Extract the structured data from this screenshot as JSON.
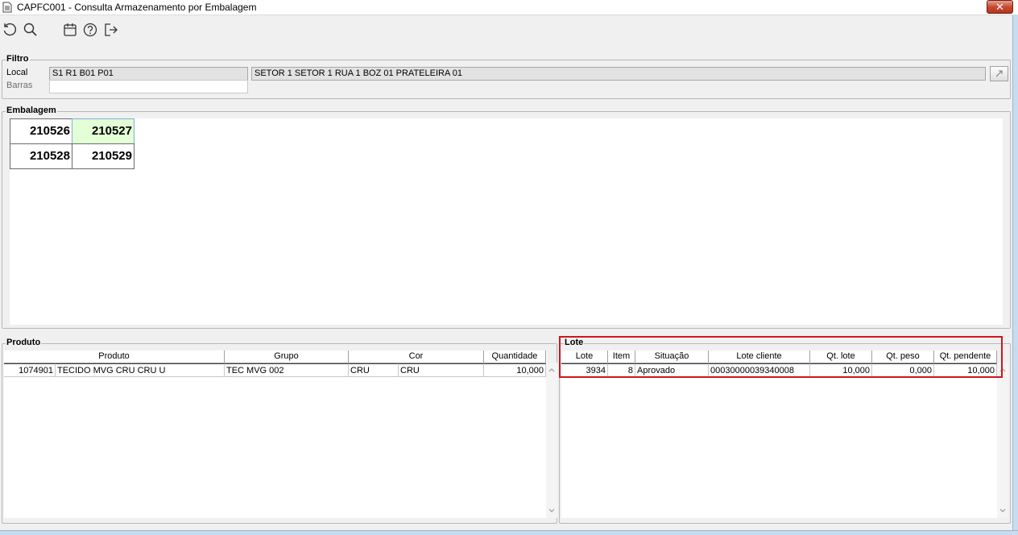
{
  "window": {
    "title": "CAPFC001 - Consulta Armazenamento por Embalagem",
    "close_label": "✕"
  },
  "toolbar": {
    "icons": [
      "refresh-icon",
      "search-icon",
      "calendar-icon",
      "help-icon",
      "exit-icon"
    ]
  },
  "filtro": {
    "legend": "Filtro",
    "local_label": "Local",
    "local_value": "S1 R1 B01 P01",
    "local_desc": "SETOR 1 SETOR 1 RUA 1 BOZ 01 PRATELEIRA 01",
    "barras_label": "Barras",
    "barras_value": ""
  },
  "embalagem": {
    "legend": "Embalagem",
    "cells": [
      "210526",
      "210527",
      "210528",
      "210529"
    ],
    "selected": "210527"
  },
  "produto": {
    "legend": "Produto",
    "columns": [
      "Produto",
      "Grupo",
      "Cor",
      "Quantidade"
    ],
    "rows": [
      {
        "codigo": "1074901",
        "produto": "TECIDO MVG CRU CRU U",
        "grupo": "TEC MVG 002",
        "cor_codigo": "CRU",
        "cor": "CRU",
        "quantidade": "10,000"
      }
    ]
  },
  "lote": {
    "legend": "Lote",
    "columns": [
      "Lote",
      "Item",
      "Situação",
      "Lote cliente",
      "Qt. lote",
      "Qt. peso",
      "Qt. pendente"
    ],
    "rows": [
      {
        "lote": "3934",
        "item": "8",
        "situacao": "Aprovado",
        "lote_cliente": "00030000039340008",
        "qt_lote": "10,000",
        "qt_peso": "0,000",
        "qt_pendente": "10,000"
      }
    ]
  },
  "colors": {
    "highlight": "#d0161f",
    "selected_cell": "#e3ffd6"
  }
}
